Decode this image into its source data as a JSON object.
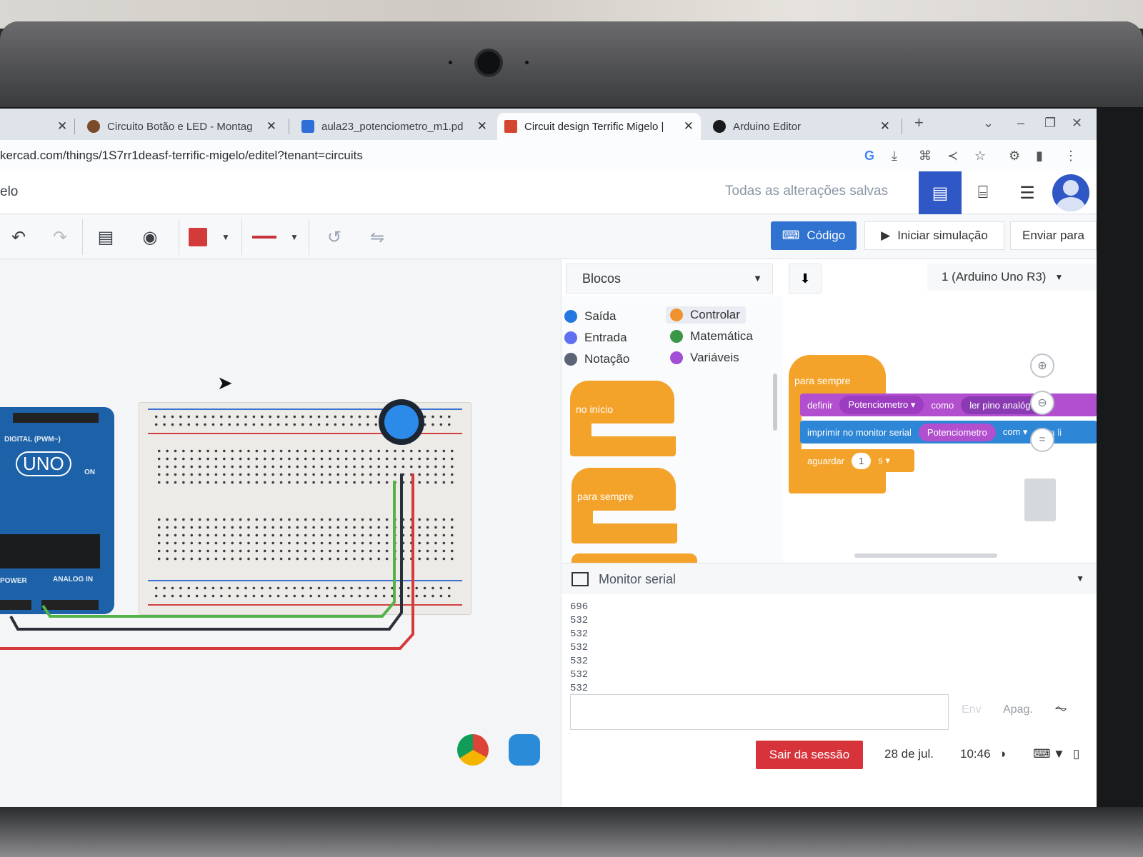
{
  "browser": {
    "tabs": [
      {
        "title": "",
        "fav_color": "#dfe3ea"
      },
      {
        "title": "Circuito Botão e LED - Montag",
        "fav_color": "#7a4b2a"
      },
      {
        "title": "aula23_potenciometro_m1.pd",
        "fav_color": "#2d6fd6"
      },
      {
        "title": "Circuit design Terrific Migelo | ",
        "fav_color": "#d4462f"
      },
      {
        "title": "Arduino Editor",
        "fav_color": "#1a1a1a"
      }
    ],
    "url": "kercad.com/things/1S7rr1deasf-terrific-migelo/editel?tenant=circuits"
  },
  "app": {
    "project_name": "elo",
    "save_status": "Todas as alterações salvas",
    "code_button": "Código",
    "sim_button": "Iniciar simulação",
    "send_button": "Enviar para"
  },
  "code": {
    "mode": "Blocos",
    "board": "1 (Arduino Uno R3)",
    "categories": [
      {
        "label": "Saída",
        "color": "#2477e0"
      },
      {
        "label": "Entrada",
        "color": "#5f6ff0"
      },
      {
        "label": "Notação",
        "color": "#5b6575"
      },
      {
        "label": "Controlar",
        "color": "#f0922e"
      },
      {
        "label": "Matemática",
        "color": "#3b9748"
      },
      {
        "label": "Variáveis",
        "color": "#a24ed6"
      }
    ],
    "palette_blocks": [
      "no início",
      "para sempre"
    ],
    "program": {
      "loop": "para sempre",
      "define": "definir",
      "variable": "Potenciometro",
      "as": "como",
      "read": "ler pino analógico",
      "print": "imprimir no monitor serial",
      "print_var": "Potenciometro",
      "with": "com",
      "newline": "nova li",
      "wait": "aguardar",
      "wait_value": "1",
      "wait_unit": "s"
    }
  },
  "serial": {
    "title": "Monitor serial",
    "lines": [
      "696",
      "532",
      "532",
      "532",
      "532",
      "532",
      "532"
    ],
    "send": "Env",
    "clear": "Apag."
  },
  "board": {
    "label": "UNO",
    "digital": "DIGITAL (PWM~)",
    "power": "POWER",
    "analog": "ANALOG IN",
    "on": "ON"
  },
  "shelf": {
    "logout": "Sair da sessão",
    "date": "28 de jul.",
    "time": "10:46"
  }
}
